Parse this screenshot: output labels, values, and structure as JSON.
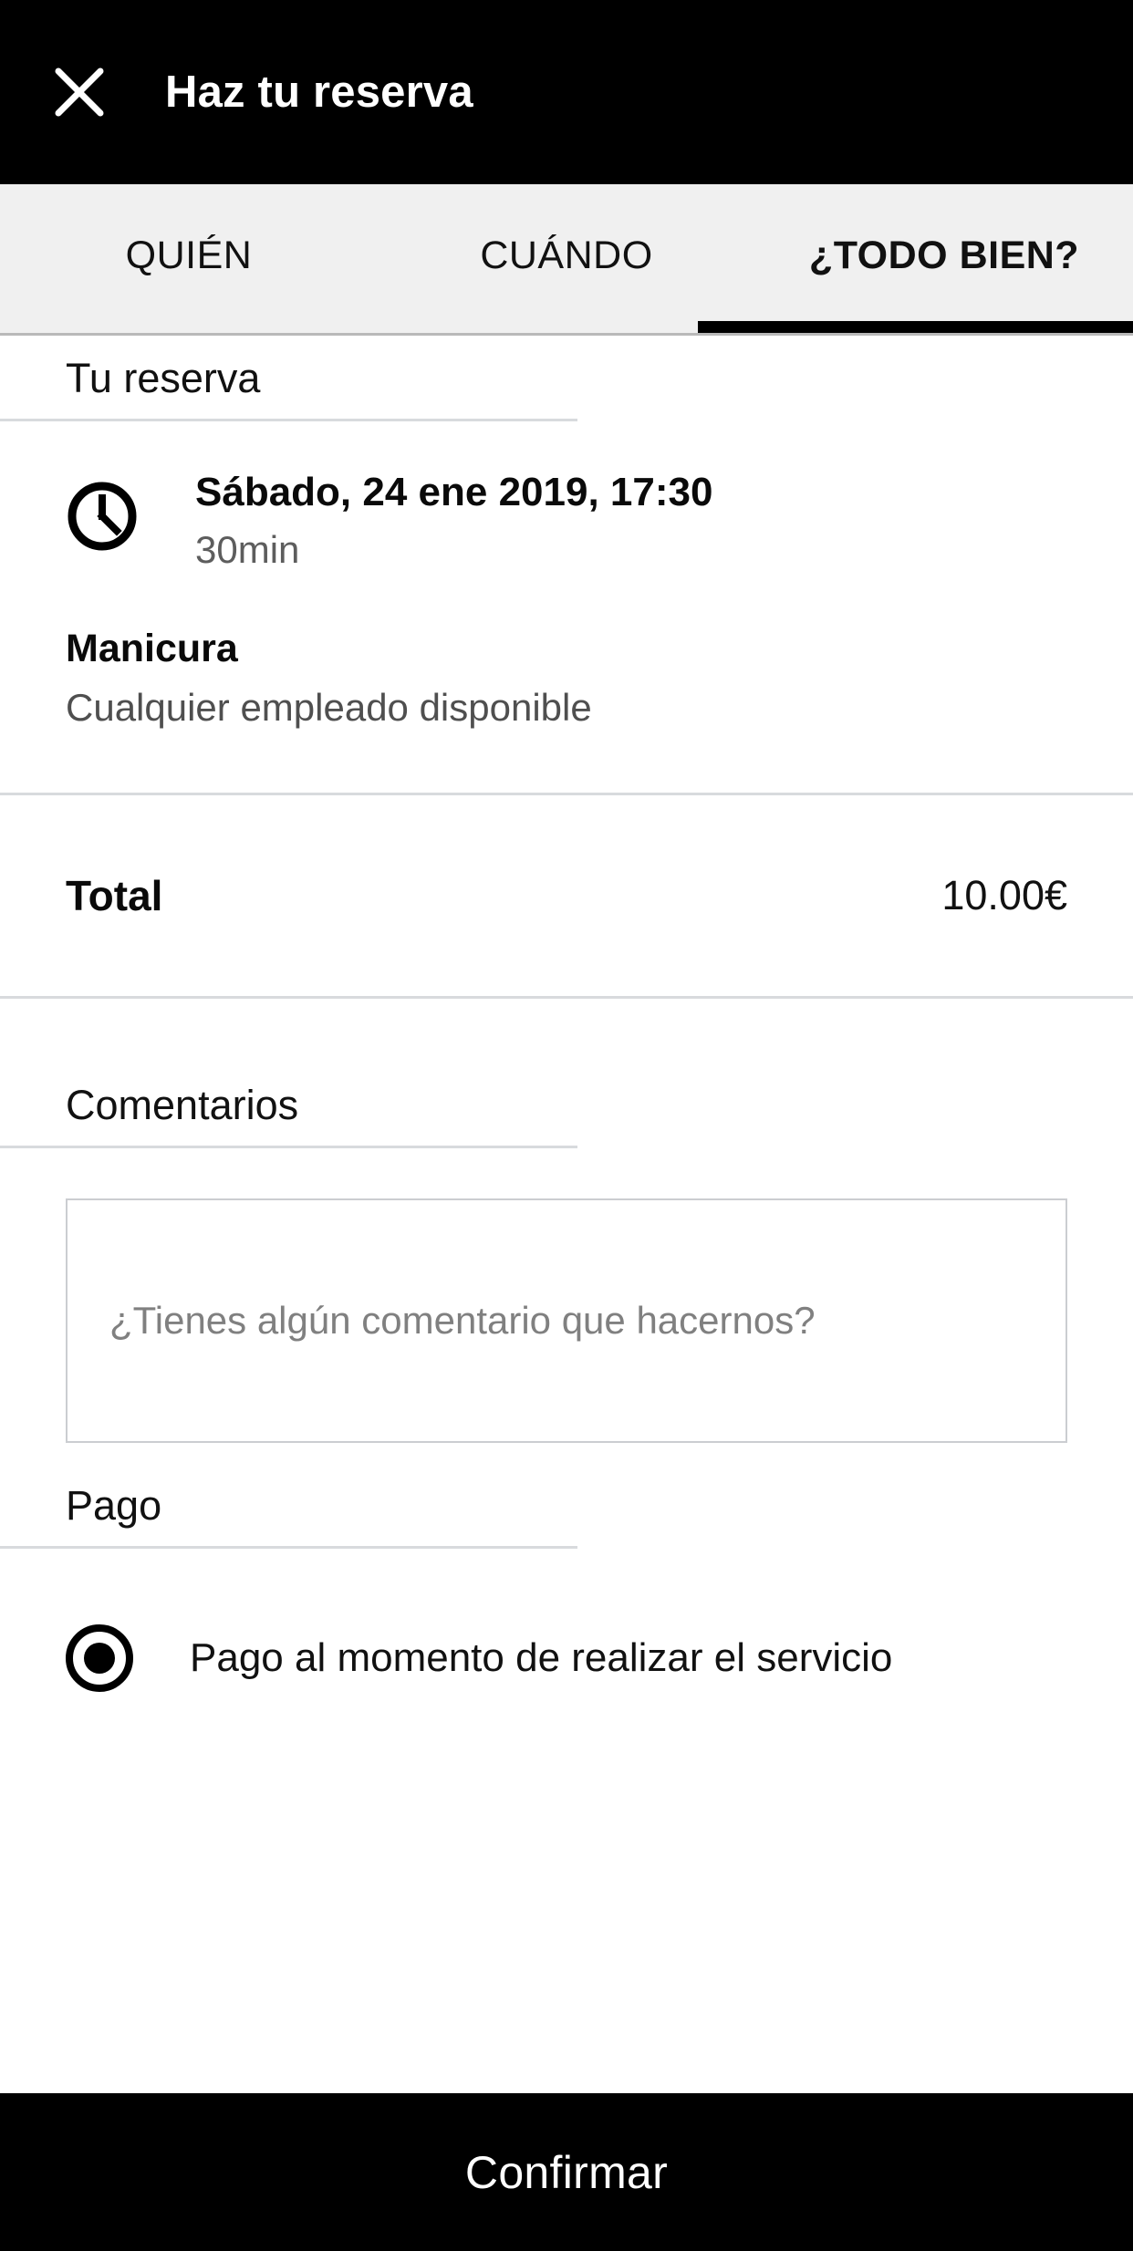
{
  "appbar": {
    "close_icon": "close-icon",
    "title": "Haz tu reserva"
  },
  "tabs": {
    "items": [
      {
        "label": "QUIÉN",
        "active": false
      },
      {
        "label": "CUÁNDO",
        "active": false
      },
      {
        "label": "¿TODO BIEN?",
        "active": true
      }
    ]
  },
  "booking": {
    "section_title": "Tu reserva",
    "clock_icon": "clock-icon",
    "datetime": "Sábado, 24 ene 2019, 17:30",
    "duration": "30min",
    "service_name": "Manicura",
    "service_staff": "Cualquier empleado disponible"
  },
  "total": {
    "label": "Total",
    "value": "10.00€"
  },
  "comments": {
    "section_title": "Comentarios",
    "placeholder": "¿Tienes algún comentario que hacernos?",
    "value": ""
  },
  "payment": {
    "section_title": "Pago",
    "options": [
      {
        "label": "Pago al momento de realizar el servicio",
        "selected": true
      }
    ]
  },
  "footer": {
    "confirm_label": "Confirmar"
  },
  "colors": {
    "bar": "#000000",
    "tab_bg": "#f0f0f0",
    "divider": "#d8dadd",
    "accent": "#000000",
    "muted_text": "#5d5d5d"
  }
}
